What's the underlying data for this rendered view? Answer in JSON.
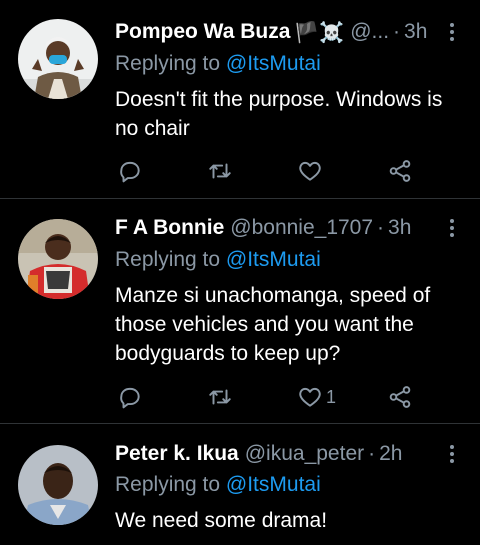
{
  "tweets": [
    {
      "name": "Pompeo Wa Buza",
      "name_emoji": "🏴☠️",
      "handle": "@...",
      "separator": "·",
      "time": "3h",
      "replying_prefix": "Replying to",
      "replying_to": "@ItsMutai",
      "text": "Doesn't fit the purpose. Windows is no chair",
      "like_count": ""
    },
    {
      "name": "F A Bonnie",
      "handle": "@bonnie_1707",
      "separator": "·",
      "time": "3h",
      "replying_prefix": "Replying to",
      "replying_to": "@ItsMutai",
      "text": "Manze si unachomanga, speed of those vehicles and you want the bodyguards to keep up?",
      "like_count": "1"
    },
    {
      "name": "Peter k. Ikua",
      "handle": "@ikua_peter",
      "separator": "·",
      "time": "2h",
      "replying_prefix": "Replying to",
      "replying_to": "@ItsMutai",
      "text": "We need some drama!",
      "like_count": ""
    }
  ],
  "icons": {
    "reply": "reply-icon",
    "retweet": "retweet-icon",
    "like": "heart-icon",
    "share": "share-icon",
    "more": "more-options-icon"
  },
  "colors": {
    "background": "#000000",
    "text": "#ffffff",
    "muted": "#8b98a5",
    "link": "#1d9bf0",
    "divider": "#2f3336"
  }
}
